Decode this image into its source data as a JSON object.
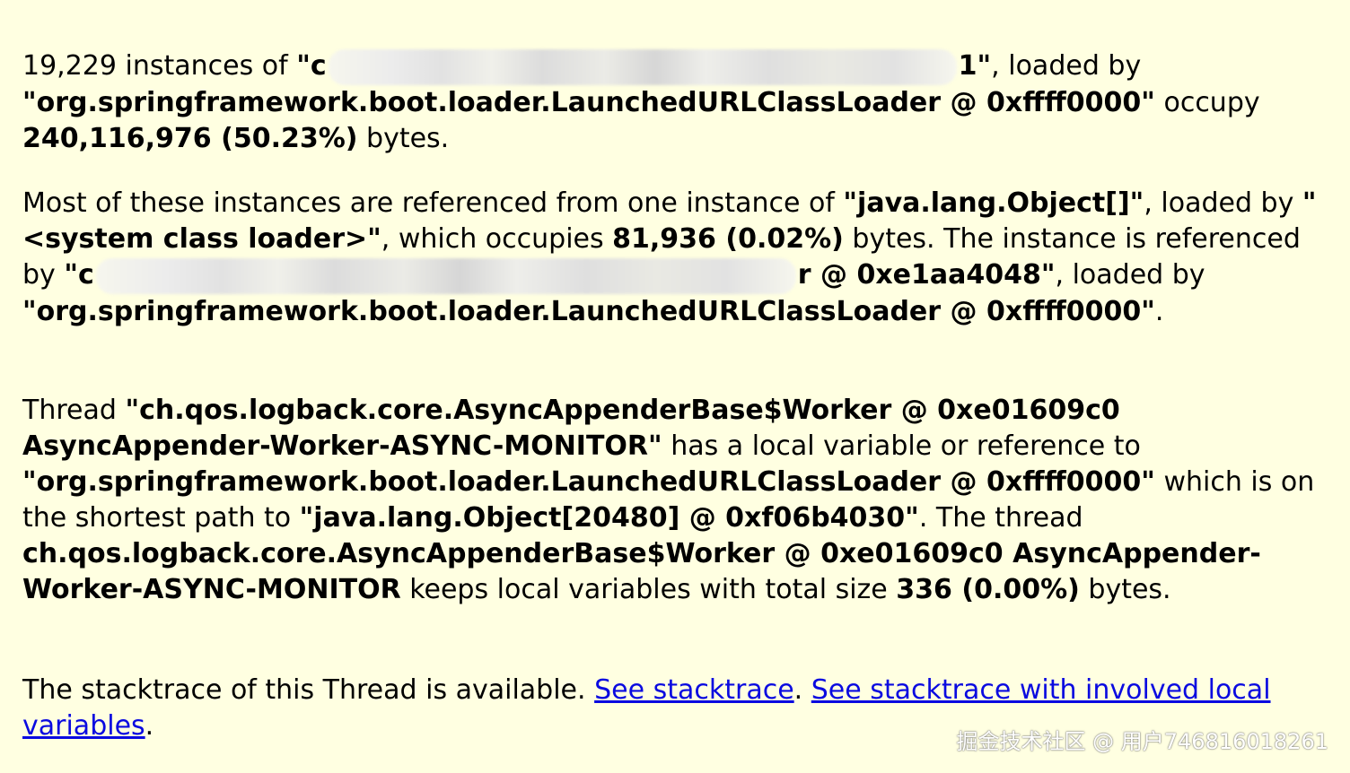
{
  "paragraph1": {
    "count": "19,229",
    "instances_of": " instances of ",
    "class_prefix": "\"c",
    "class_suffix": "1\"",
    "loaded_by": ", loaded by",
    "loader": "\"org.springframework.boot.loader.LaunchedURLClassLoader @ 0xffff0000\"",
    "occupy": "occupy ",
    "size": "240,116,976 (50.23%)",
    "bytes": " bytes."
  },
  "paragraph2": {
    "intro": "Most of these instances are referenced from one instance of ",
    "array_class": "\"java.lang.Object[]\"",
    "comma_loaded_by": ", loaded by ",
    "system_loader": "\"<system class loader>\"",
    "which_occupies": ", which occupies ",
    "size": "81,936 (0.02%)",
    "bytes_the": " bytes. The instance is referenced by ",
    "ref_prefix": "\"c",
    "ref_suffix": "r @ 0xe1aa4048\"",
    "loaded_by": ", loaded by ",
    "loader": "\"org.springframework.boot.loader.LaunchedURLClassLoader @ 0xffff0000\"",
    "end": "."
  },
  "paragraph3": {
    "thread_word": "Thread ",
    "thread_name": "\"ch.qos.logback.core.AsyncAppenderBase$Worker @ 0xe01609c0 AsyncAppender-Worker-ASYNC-MONITOR\"",
    "has_local": " has a local variable or reference to ",
    "loader": "\"org.springframework.boot.loader.LaunchedURLClassLoader @ 0xffff0000\"",
    "which_on_path": " which is on the shortest path to ",
    "array": "\"java.lang.Object[20480] @ 0xf06b4030\"",
    "the_thread": ". The thread ",
    "thread_plain": "ch.qos.logback.core.AsyncAppenderBase$Worker @ 0xe01609c0 AsyncAppender-Worker-ASYNC-MONITOR",
    "keeps": " keeps local variables with total size ",
    "size": "336 (0.00%)",
    "bytes": " bytes."
  },
  "paragraph4": {
    "text": "The stacktrace of this Thread is available. ",
    "link1": "See stacktrace",
    "sep": ". ",
    "link2": "See stacktrace with involved local variables",
    "end": "."
  },
  "watermark": "掘金技术社区 @ 用户746816018261",
  "colors": {
    "background": "#ffffe1",
    "link": "#0a0ae0"
  }
}
